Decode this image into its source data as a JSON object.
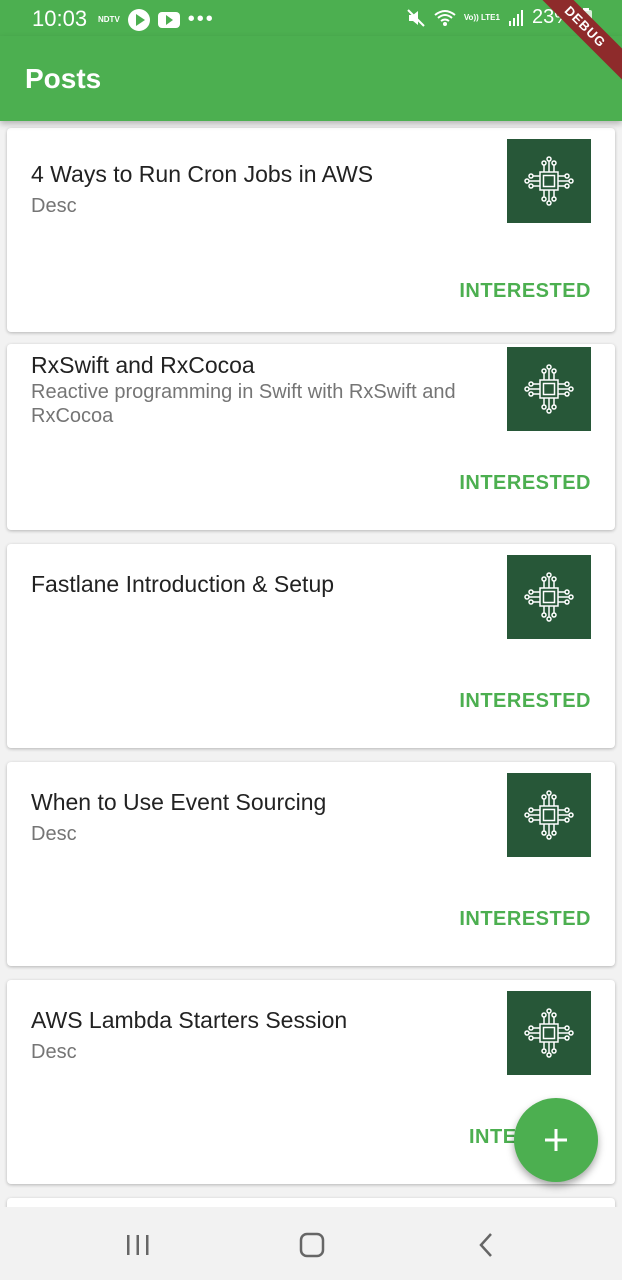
{
  "status_bar": {
    "time": "10:03",
    "left_label": "NDTV",
    "battery": "23%",
    "network": "Vo)) LTE1"
  },
  "appbar": {
    "title": "Posts"
  },
  "debug_banner": "DEBUG",
  "posts": [
    {
      "title": "4 Ways to Run Cron Jobs in AWS",
      "desc": "Desc",
      "action": "INTERESTED",
      "thumb_icon": "chip-icon"
    },
    {
      "title": "RxSwift and RxCocoa",
      "desc": "Reactive programming in Swift with RxSwift and RxCocoa",
      "action": "INTERESTED",
      "thumb_icon": "chip-icon"
    },
    {
      "title": "Fastlane Introduction & Setup",
      "desc": "",
      "action": "INTERESTED",
      "thumb_icon": "chip-icon"
    },
    {
      "title": "When to Use Event Sourcing",
      "desc": "Desc",
      "action": "INTERESTED",
      "thumb_icon": "chip-icon"
    },
    {
      "title": "AWS Lambda Starters Session",
      "desc": "Desc",
      "action": "INTE",
      "thumb_icon": "chip-icon"
    }
  ],
  "fab": {
    "icon": "plus-icon"
  },
  "nav": {
    "recent_icon": "recent-apps-icon",
    "home_icon": "home-icon",
    "back_icon": "back-icon"
  },
  "colors": {
    "primary": "#4caf50",
    "thumb_bg": "#275738",
    "ribbon": "#8e2b2b"
  }
}
